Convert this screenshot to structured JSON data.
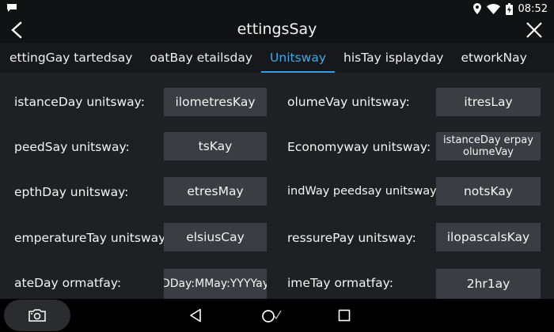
{
  "status_bar": {
    "time": "08:52"
  },
  "title_bar": {
    "title": "ettingsSay"
  },
  "tabs": [
    {
      "label": "ettingGay tartedsay",
      "active": false
    },
    {
      "label": "oatBay etailsday",
      "active": false
    },
    {
      "label": "Unitsway",
      "active": true
    },
    {
      "label": "hisTay isplayday",
      "active": false
    },
    {
      "label": "etworkNay",
      "active": false
    }
  ],
  "fields": {
    "distance": {
      "label": "istanceDay unitsway:",
      "value": "ilometresKay"
    },
    "volume": {
      "label": "olumeVay unitsway:",
      "value": "itresLay"
    },
    "speed": {
      "label": "peedSay unitsway:",
      "value": "tsKay"
    },
    "economy": {
      "label": "Economyway unitsway:",
      "value": "istanceDay erpay olumeVay"
    },
    "depth": {
      "label": "epthDay unitsway:",
      "value": "etresMay"
    },
    "wind_speed": {
      "label": "indWay peedsay unitsway:",
      "value": "notsKay"
    },
    "temperature": {
      "label": "emperatureTay unitsway:",
      "value": "elsiusCay"
    },
    "pressure": {
      "label": "ressurePay unitsway:",
      "value": "ilopascalsKay"
    },
    "date_format": {
      "label": "ateDay ormatfay:",
      "value": "DDay:MMay:YYYYay"
    },
    "time_format": {
      "label": "imeTay ormatfay:",
      "value": "2hr1ay"
    }
  },
  "colors": {
    "accent": "#3fa9e6",
    "value_box": "#3a3e42",
    "content_bg": "#1e2124"
  }
}
